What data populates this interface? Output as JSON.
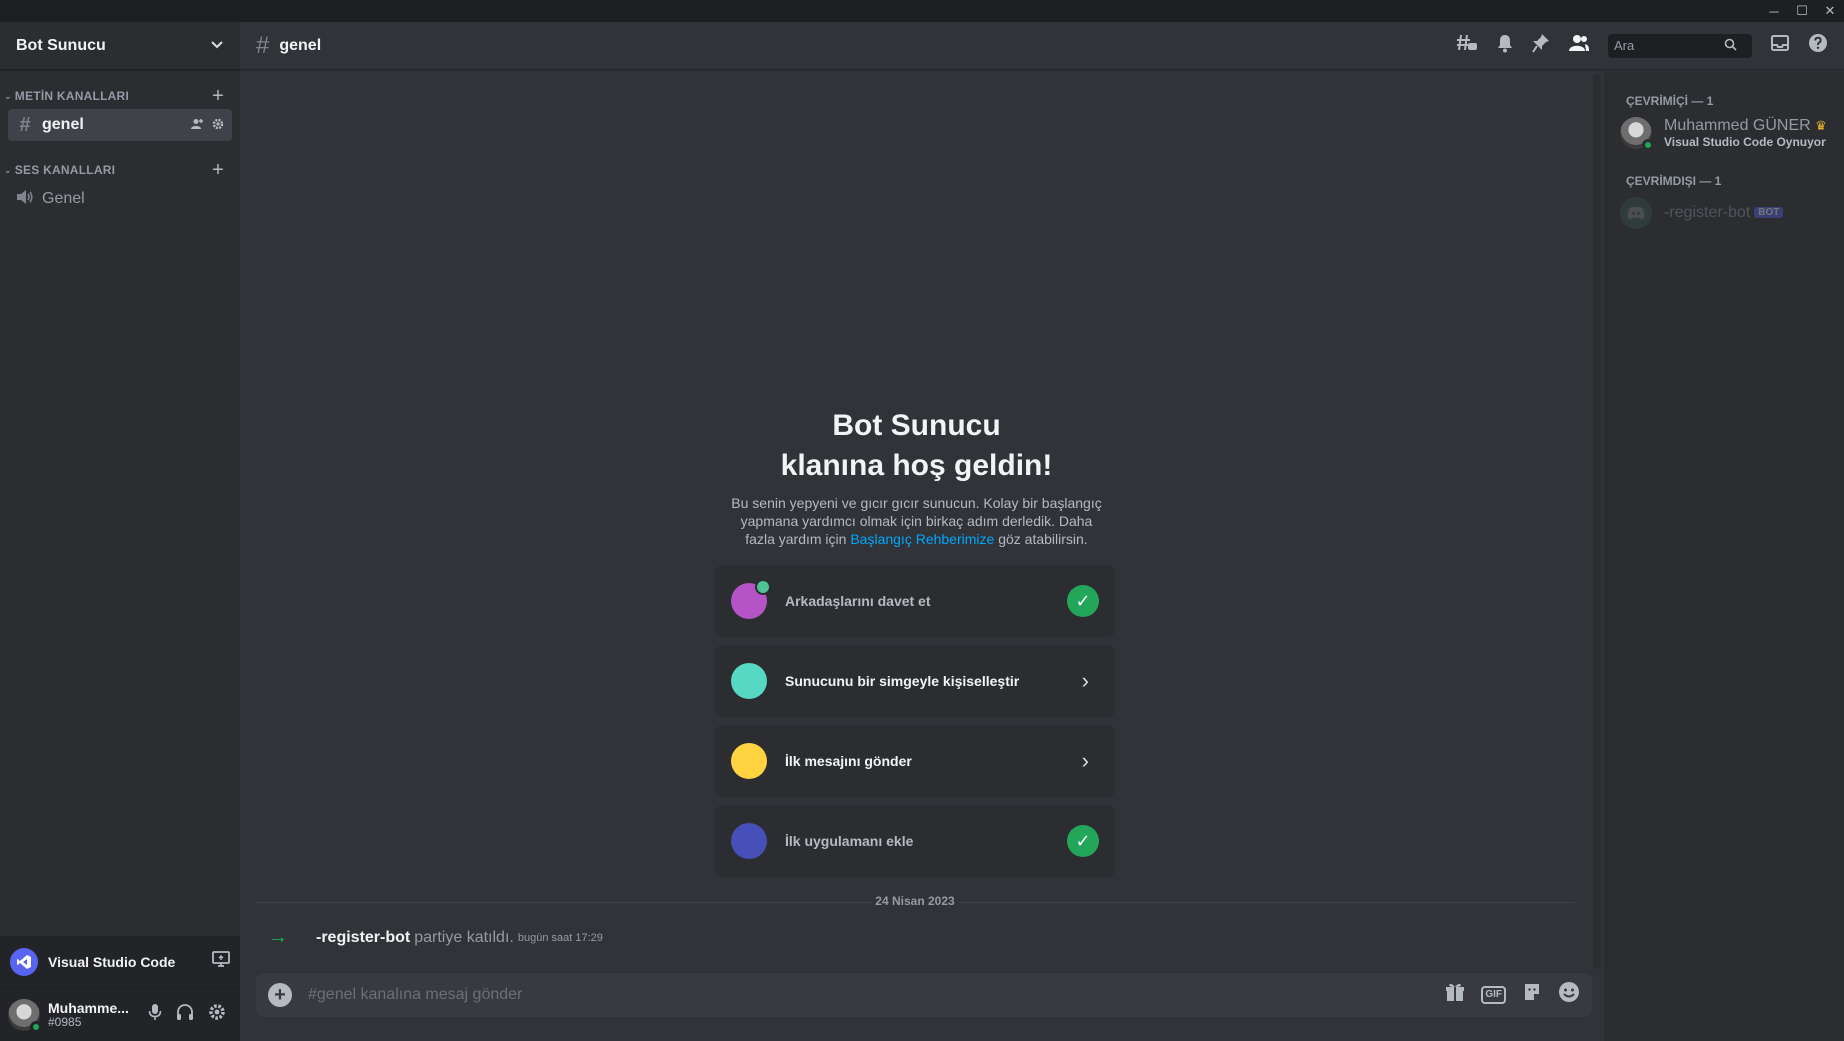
{
  "window": {
    "minimize": "─",
    "maximize": "☐",
    "close": "✕"
  },
  "server": {
    "name": "Bot Sunucu"
  },
  "categories": {
    "text": {
      "label": "METİN KANALLARI"
    },
    "voice": {
      "label": "SES KANALLARI"
    }
  },
  "channels": {
    "text": [
      {
        "name": "genel"
      }
    ],
    "voice": [
      {
        "name": "Genel"
      }
    ]
  },
  "activity": {
    "app": "Visual Studio Code"
  },
  "user": {
    "name": "Muhamme...",
    "tag": "#0985",
    "status_color": "#23a55a"
  },
  "topbar": {
    "channel": "genel",
    "search_placeholder": "Ara"
  },
  "welcome": {
    "title_line1": "Bot Sunucu",
    "title_line2": "klanına hoş geldin!",
    "desc_before": "Bu senin yepyeni ve gıcır gıcır sunucun. Kolay bir başlangıç yapmana yardımcı olmak için birkaç adım derledik. Daha fazla yardım için ",
    "desc_link": "Başlangıç Rehberimize",
    "desc_after": " göz atabilirsin."
  },
  "cards": [
    {
      "label": "Arkadaşlarını davet et",
      "state": "done"
    },
    {
      "label": "Sunucunu bir simgeyle kişiselleştir",
      "state": "todo"
    },
    {
      "label": "İlk mesajını gönder",
      "state": "todo"
    },
    {
      "label": "İlk uygulamanı ekle",
      "state": "done"
    }
  ],
  "date_divider": "24 Nisan 2023",
  "join_message": {
    "user": "-register-bot",
    "text": "partiye katıldı.",
    "time": "bugün saat 17:29"
  },
  "composer": {
    "placeholder": "#genel kanalına mesaj gönder",
    "gif": "GIF"
  },
  "members": {
    "online_header": "ÇEVRİMİÇİ — 1",
    "offline_header": "ÇEVRİMDIŞI — 1",
    "online": [
      {
        "name": "Muhammed GÜNER",
        "activity": "Visual Studio Code Oynuyor"
      }
    ],
    "offline": [
      {
        "name": "-register-bot",
        "badge": "BOT"
      }
    ]
  },
  "colors": {
    "accent": "#5865f2",
    "online": "#23a55a",
    "link": "#00a8fc"
  }
}
